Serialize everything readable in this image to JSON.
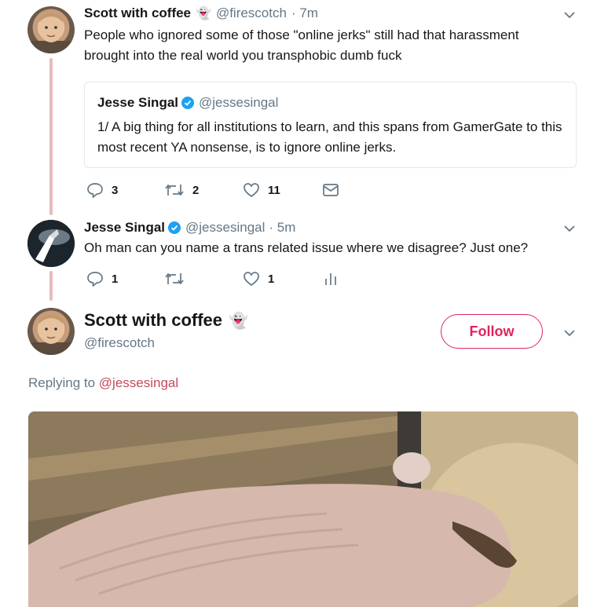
{
  "tweets": [
    {
      "name": "Scott with coffee",
      "handle": "@firescotch",
      "time": "· 7m",
      "text": "People who ignored some of those \"online jerks\" still had that harassment brought into the real world you transphobic dumb fuck",
      "quote": {
        "name": "Jesse Singal",
        "handle": "@jessesingal",
        "text": "1/ A big thing for all institutions to learn, and this spans from GamerGate to this most recent YA nonsense, is to ignore online jerks."
      },
      "actions": {
        "replies": "3",
        "retweets": "2",
        "likes": "11"
      }
    },
    {
      "name": "Jesse Singal",
      "handle": "@jessesingal",
      "time": "· 5m",
      "text": "Oh man can you name a trans related issue where we disagree? Just one?",
      "actions": {
        "replies": "1",
        "retweets": "",
        "likes": "1"
      }
    }
  ],
  "main": {
    "name": "Scott with coffee",
    "handle": "@firescotch",
    "follow_label": "Follow",
    "replying_prefix": "Replying to",
    "replying_to": "@jessesingal"
  },
  "colors": {
    "accent": "#e0245e",
    "verified": "#1da1f2",
    "thread_line": "#e6bcbc",
    "muted": "#657786"
  },
  "icons": [
    "ghost-emoji-icon",
    "chevron-down-icon",
    "verified-badge-icon",
    "reply-icon",
    "retweet-icon",
    "like-icon",
    "dm-icon",
    "analytics-icon"
  ]
}
